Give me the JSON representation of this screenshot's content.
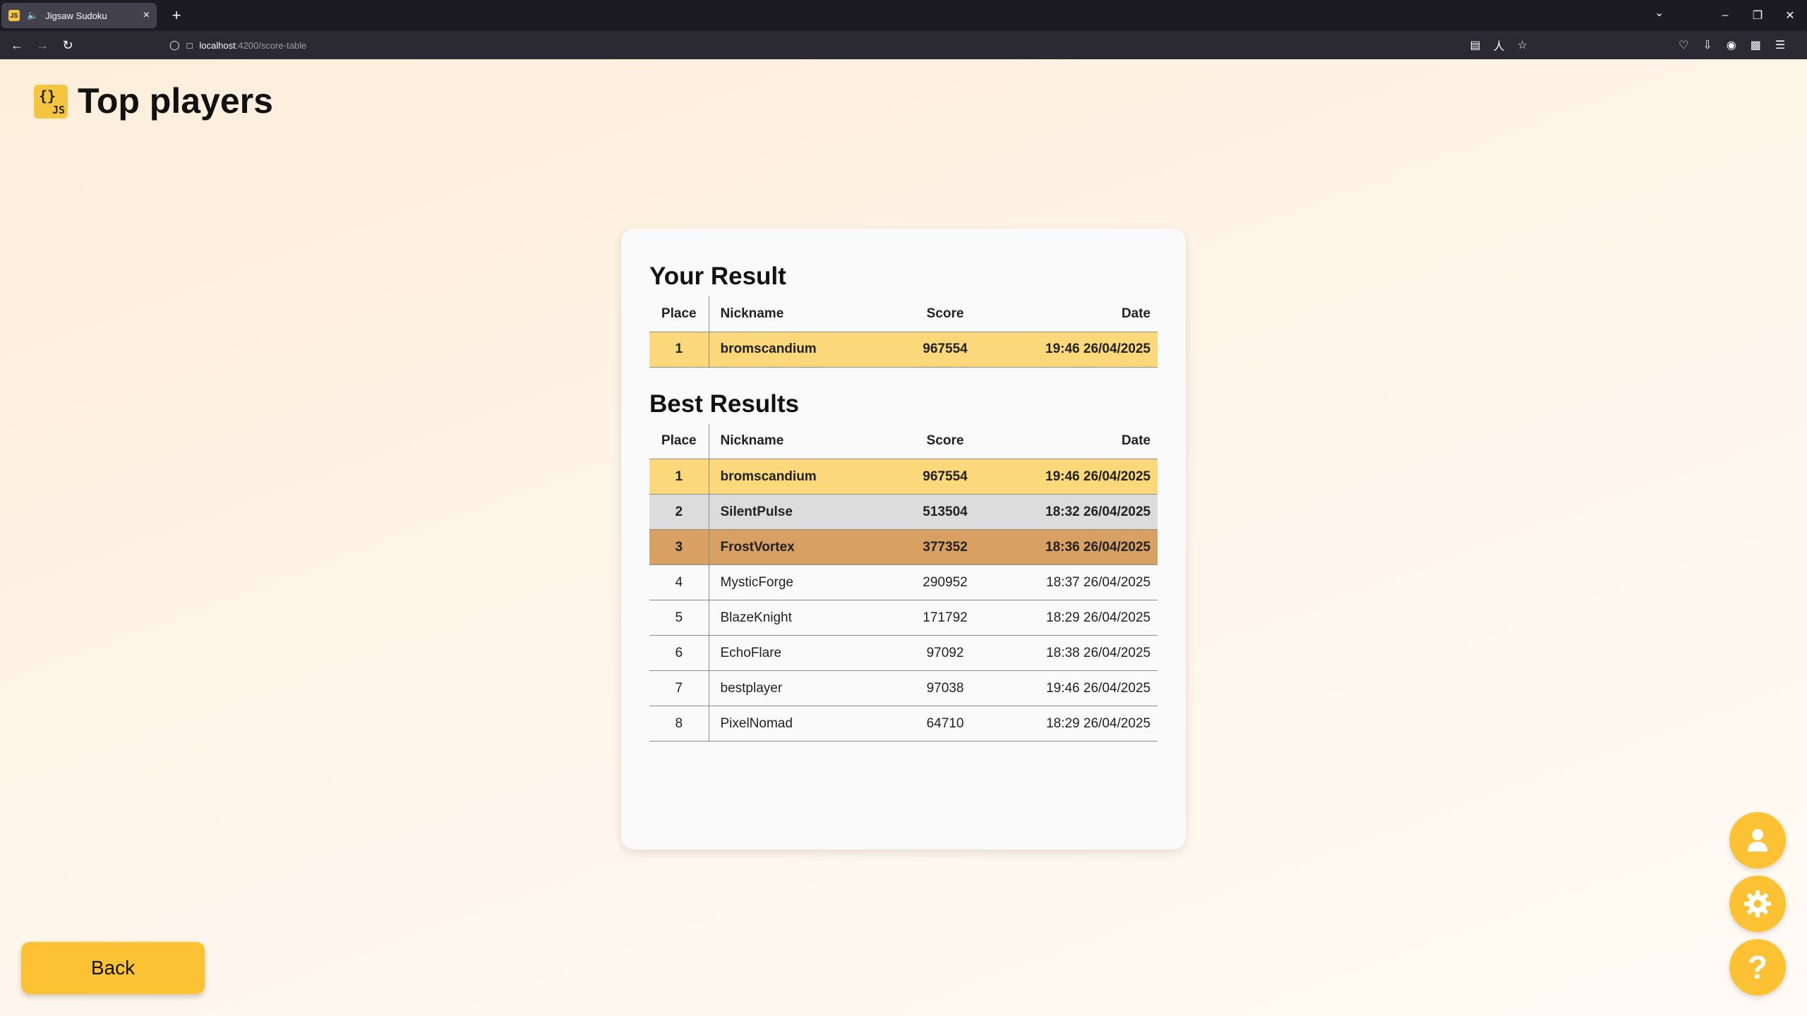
{
  "browser": {
    "tab_title": "Jigsaw Sudoku",
    "url_host": "localhost",
    "url_path": ":4200/score-table"
  },
  "page": {
    "title": "Top players",
    "back_label": "Back"
  },
  "your_result": {
    "heading": "Your Result",
    "columns": {
      "place": "Place",
      "nickname": "Nickname",
      "score": "Score",
      "date": "Date"
    },
    "row": {
      "place": "1",
      "nickname": "bromscandium",
      "score": "967554",
      "date": "19:46 26/04/2025"
    }
  },
  "best_results": {
    "heading": "Best Results",
    "columns": {
      "place": "Place",
      "nickname": "Nickname",
      "score": "Score",
      "date": "Date"
    },
    "rows": [
      {
        "place": "1",
        "nickname": "bromscandium",
        "score": "967554",
        "date": "19:46 26/04/2025",
        "highlight": "gold"
      },
      {
        "place": "2",
        "nickname": "SilentPulse",
        "score": "513504",
        "date": "18:32 26/04/2025",
        "highlight": "silver"
      },
      {
        "place": "3",
        "nickname": "FrostVortex",
        "score": "377352",
        "date": "18:36 26/04/2025",
        "highlight": "bronze"
      },
      {
        "place": "4",
        "nickname": "MysticForge",
        "score": "290952",
        "date": "18:37 26/04/2025",
        "highlight": ""
      },
      {
        "place": "5",
        "nickname": "BlazeKnight",
        "score": "171792",
        "date": "18:29 26/04/2025",
        "highlight": ""
      },
      {
        "place": "6",
        "nickname": "EchoFlare",
        "score": "97092",
        "date": "18:38 26/04/2025",
        "highlight": ""
      },
      {
        "place": "7",
        "nickname": "bestplayer",
        "score": "97038",
        "date": "19:46 26/04/2025",
        "highlight": ""
      },
      {
        "place": "8",
        "nickname": "PixelNomad",
        "score": "64710",
        "date": "18:29 26/04/2025",
        "highlight": ""
      }
    ]
  },
  "colors": {
    "accent": "#fcc233",
    "gold_row": "#fbd97a",
    "silver_row": "#dcdcdc",
    "bronze_row": "#d9a064"
  },
  "icons": {
    "fab_profile": "user-icon",
    "fab_settings": "gear-icon",
    "fab_help": "help-icon"
  }
}
